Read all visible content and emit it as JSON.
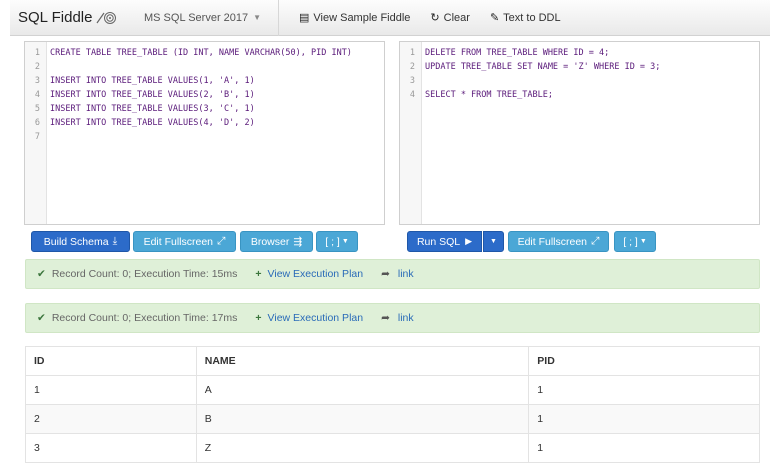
{
  "navbar": {
    "brand": "SQL Fiddle",
    "db": "MS SQL Server 2017",
    "links": [
      {
        "icon": "document-icon",
        "label": "View Sample Fiddle"
      },
      {
        "icon": "refresh-icon",
        "label": "Clear"
      },
      {
        "icon": "wrench-icon",
        "label": "Text to DDL"
      }
    ]
  },
  "schema_panel": {
    "lines": [
      {
        "n": "1",
        "t": "CREATE TABLE TREE_TABLE (ID INT, NAME VARCHAR(50), PID INT)"
      },
      {
        "n": "2",
        "t": ""
      },
      {
        "n": "3",
        "t": "INSERT INTO TREE_TABLE VALUES(1, 'A', 1)"
      },
      {
        "n": "4",
        "t": "INSERT INTO TREE_TABLE VALUES(2, 'B', 1)"
      },
      {
        "n": "5",
        "t": "INSERT INTO TREE_TABLE VALUES(3, 'C', 1)"
      },
      {
        "n": "6",
        "t": "INSERT INTO TREE_TABLE VALUES(4, 'D', 2)"
      },
      {
        "n": "7",
        "t": ""
      }
    ]
  },
  "query_panel": {
    "lines": [
      {
        "n": "1",
        "t": "DELETE FROM TREE_TABLE WHERE ID = 4;"
      },
      {
        "n": "2",
        "t": "UPDATE TREE_TABLE SET NAME = 'Z' WHERE ID = 3;"
      },
      {
        "n": "3",
        "t": ""
      },
      {
        "n": "4",
        "t": "SELECT * FROM TREE_TABLE;"
      }
    ]
  },
  "left_buttons": {
    "build_schema": "Build Schema",
    "edit_fullscreen": "Edit Fullscreen",
    "browser": "Browser",
    "delimiter": "[ ; ]"
  },
  "right_buttons": {
    "run_sql": "Run SQL",
    "edit_fullscreen": "Edit Fullscreen",
    "delimiter": "[ ; ]"
  },
  "results": [
    {
      "record": "Record Count: 0; Execution Time: 15ms",
      "plan": "View Execution Plan",
      "link": "link"
    },
    {
      "record": "Record Count: 0; Execution Time: 17ms",
      "plan": "View Execution Plan",
      "link": "link"
    }
  ],
  "table": {
    "headers": [
      "ID",
      "NAME",
      "PID"
    ],
    "rows": [
      [
        "1",
        "A",
        "1"
      ],
      [
        "2",
        "B",
        "1"
      ],
      [
        "3",
        "Z",
        "1"
      ]
    ]
  },
  "colors": {
    "primary": "#2c6bc9",
    "info": "#4ba7d6",
    "success_bg": "#dff0d8"
  }
}
